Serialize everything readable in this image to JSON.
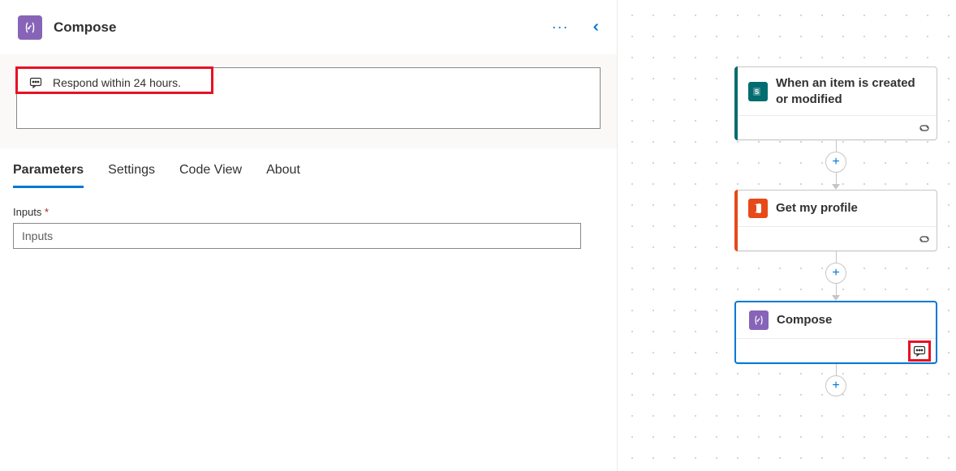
{
  "panel": {
    "title": "Compose",
    "note_text": "Respond within 24 hours.",
    "tabs": [
      "Parameters",
      "Settings",
      "Code View",
      "About"
    ],
    "active_tab": 0,
    "inputs_label": "Inputs",
    "inputs_placeholder": "Inputs",
    "inputs_value": ""
  },
  "icons": {
    "compose": "compose-icon",
    "more": "···",
    "collapse": "‹‹",
    "note": "note-icon",
    "link": "link-icon",
    "plus": "+",
    "sharepoint": "S"
  },
  "flow": {
    "nodes": [
      {
        "title": "When an item is created or modified",
        "accent": "#036c70",
        "icon": "sharepoint",
        "footer": "link",
        "selected": false
      },
      {
        "title": "Get my profile",
        "accent": "#e64a19",
        "icon": "o365",
        "footer": "link",
        "selected": false
      },
      {
        "title": "Compose",
        "accent": "#8764b8",
        "icon": "compose",
        "footer": "note-highlight",
        "selected": true
      }
    ]
  }
}
